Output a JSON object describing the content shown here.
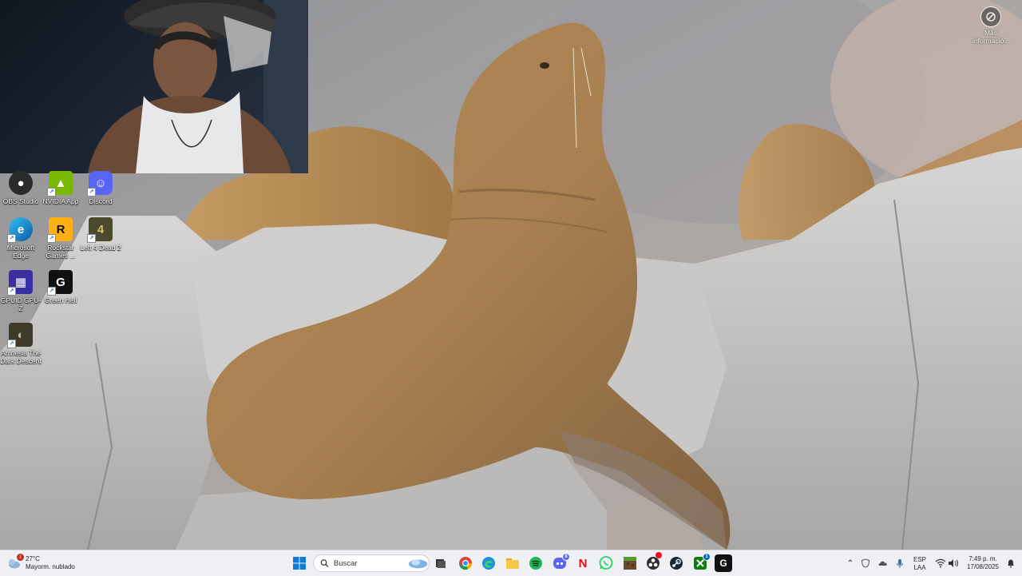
{
  "desktop": {
    "icons": [
      {
        "label": "OBS Studio",
        "icon": "obs-icon"
      },
      {
        "label": "NVIDIA App",
        "icon": "nvidia-icon"
      },
      {
        "label": "Discord",
        "icon": "discord-icon"
      },
      {
        "label": "Microsoft Edge",
        "icon": "edge-icon"
      },
      {
        "label": "Rockstar Games ...",
        "icon": "rockstar-icon"
      },
      {
        "label": "Left 4 Dead 2",
        "icon": "left4dead2-icon"
      },
      {
        "label": "GPUID GPU-Z",
        "icon": "gpuz-icon"
      },
      {
        "label": "Green Hell",
        "icon": "greenhell-icon"
      },
      {
        "label": "Amnesia The Dark Descent",
        "icon": "amnesia-icon"
      }
    ],
    "info_button": {
      "label": "Más informació..."
    }
  },
  "taskbar": {
    "weather": {
      "temp": "27°C",
      "condition": "Mayorm. nublado",
      "notification_count": "1"
    },
    "search": {
      "placeholder": "Buscar"
    },
    "apps": [
      {
        "icon": "windows-start-icon"
      },
      {
        "icon": "task-view-icon"
      },
      {
        "icon": "chrome-icon"
      },
      {
        "icon": "edge-icon"
      },
      {
        "icon": "file-explorer-icon"
      },
      {
        "icon": "spotify-icon"
      },
      {
        "icon": "discord-icon",
        "badge": "8"
      },
      {
        "icon": "netflix-icon"
      },
      {
        "icon": "whatsapp-icon"
      },
      {
        "icon": "minecraft-icon"
      },
      {
        "icon": "obs-icon"
      },
      {
        "icon": "steam-icon"
      },
      {
        "icon": "xbox-icon",
        "badge": "1"
      },
      {
        "icon": "greenhell-icon"
      }
    ],
    "tray": {
      "language_line1": "ESP",
      "language_line2": "LAA",
      "time": "7:49 p. m.",
      "date": "17/08/2025"
    }
  },
  "colors": {
    "taskbar_bg": "#eef0f3",
    "accent": "#0067c0"
  }
}
